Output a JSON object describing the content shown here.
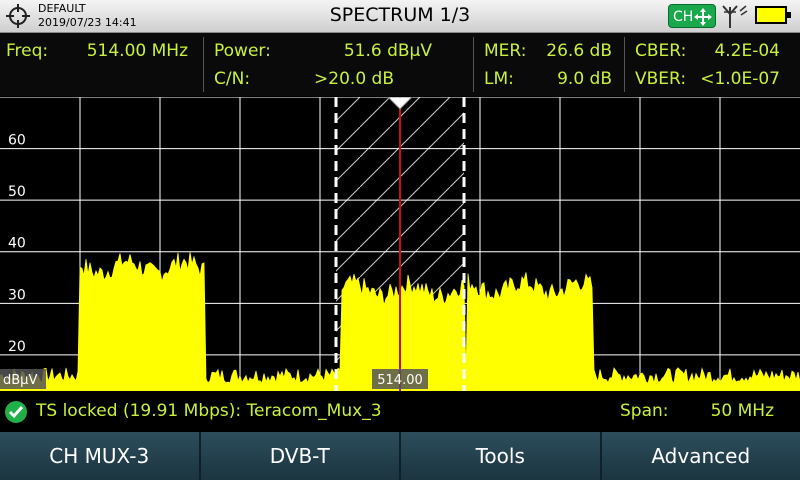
{
  "header": {
    "preset": "DEFAULT",
    "datetime": "2019/07/23 14:41",
    "title": "SPECTRUM 1/3",
    "mode_badge": "CH"
  },
  "measurements": {
    "freq_label": "Freq:",
    "freq_value": "514.00 MHz",
    "power_label": "Power:",
    "power_value": "51.6 dBµV",
    "cn_label": "C/N:",
    "cn_value": ">20.0 dB",
    "mer_label": "MER:",
    "mer_value": "26.6 dB",
    "lm_label": "LM:",
    "lm_value": "9.0 dB",
    "cber_label": "CBER:",
    "cber_value": "4.2E-04",
    "vber_label": "VBER:",
    "vber_value": "<1.0E-07"
  },
  "chart_data": {
    "type": "area",
    "y_unit_label": "dBµV",
    "y_ticks": [
      20,
      30,
      40,
      50,
      60
    ],
    "ylim": [
      13,
      70
    ],
    "xlim_mhz": [
      489,
      539
    ],
    "span_mhz": 50,
    "marker_label": "514.00",
    "marker_mhz": 514.0,
    "channel_window_mhz": [
      510.0,
      518.0
    ],
    "grid": true,
    "noise_floor_db": 16,
    "bands": [
      {
        "from_mhz": 494.0,
        "to_mhz": 501.8,
        "level_db": 37
      },
      {
        "from_mhz": 510.3,
        "to_mhz": 518.0,
        "level_db": 32.5
      },
      {
        "from_mhz": 518.2,
        "to_mhz": 526.0,
        "level_db": 33
      }
    ],
    "colors": {
      "trace": "#ffff00",
      "marker": "#cc1111",
      "grid": "#ffffff",
      "window": "#ffffff"
    }
  },
  "status": {
    "ts_text": "TS locked (19.91 Mbps): Teracom_Mux_3",
    "span_label": "Span:",
    "span_value": "50 MHz"
  },
  "softkeys": [
    "CH MUX-3",
    "DVB-T",
    "Tools",
    "Advanced"
  ]
}
